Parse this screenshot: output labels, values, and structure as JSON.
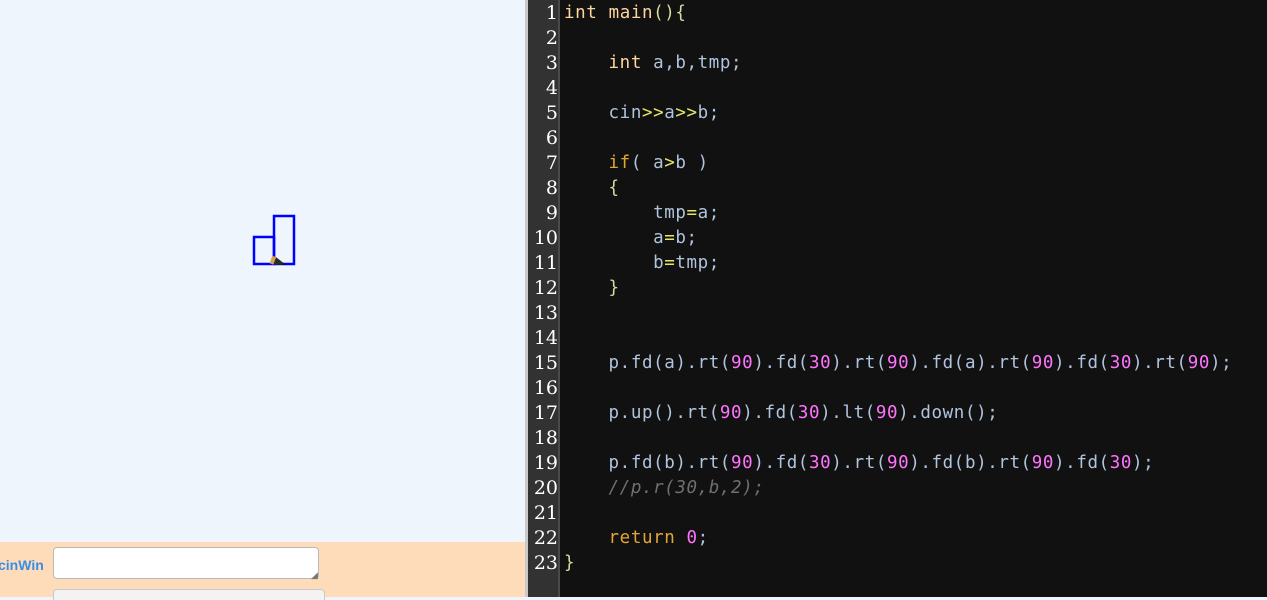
{
  "input": {
    "label": "cinWin",
    "value": ""
  },
  "colors": {
    "canvas_background": "#eef5fd",
    "input_strip_background": "#ffdcb9",
    "editor_background": "#111111",
    "gutter_background": "#323232",
    "turtle_stroke": "#0000ff",
    "keyword": "#ffd59e",
    "control_keyword": "#e2a733",
    "number": "#ff73fd",
    "operator": "#e6e66a",
    "identifier": "#b0c4de",
    "comment": "#6f6f6f"
  },
  "editor": {
    "line_numbers": [
      "1",
      "2",
      "3",
      "4",
      "5",
      "6",
      "7",
      "8",
      "9",
      "10",
      "11",
      "12",
      "13",
      "14",
      "15",
      "16",
      "17",
      "18",
      "19",
      "20",
      "21",
      "22",
      "23"
    ],
    "lines": [
      [
        {
          "t": "int",
          "k": "kw"
        },
        {
          "t": " "
        },
        {
          "t": "main",
          "k": "kw"
        },
        {
          "t": "(){",
          "k": "brace"
        }
      ],
      [],
      [
        {
          "t": "    "
        },
        {
          "t": "int",
          "k": "kw"
        },
        {
          "t": " a,b,tmp;"
        }
      ],
      [],
      [
        {
          "t": "    cin"
        },
        {
          "t": ">>",
          "k": "op"
        },
        {
          "t": "a"
        },
        {
          "t": ">>",
          "k": "op"
        },
        {
          "t": "b;"
        }
      ],
      [],
      [
        {
          "t": "    "
        },
        {
          "t": "if",
          "k": "ctl"
        },
        {
          "t": "( a"
        },
        {
          "t": ">",
          "k": "op"
        },
        {
          "t": "b )"
        }
      ],
      [
        {
          "t": "    "
        },
        {
          "t": "{",
          "k": "brace"
        }
      ],
      [
        {
          "t": "        tmp"
        },
        {
          "t": "=",
          "k": "op"
        },
        {
          "t": "a;"
        }
      ],
      [
        {
          "t": "        a"
        },
        {
          "t": "=",
          "k": "op"
        },
        {
          "t": "b;"
        }
      ],
      [
        {
          "t": "        b"
        },
        {
          "t": "=",
          "k": "op"
        },
        {
          "t": "tmp;"
        }
      ],
      [
        {
          "t": "    "
        },
        {
          "t": "}",
          "k": "brace"
        }
      ],
      [],
      [],
      [
        {
          "t": "    p.fd(a).rt("
        },
        {
          "t": "90",
          "k": "num"
        },
        {
          "t": ").fd("
        },
        {
          "t": "30",
          "k": "num"
        },
        {
          "t": ").rt("
        },
        {
          "t": "90",
          "k": "num"
        },
        {
          "t": ").fd(a).rt("
        },
        {
          "t": "90",
          "k": "num"
        },
        {
          "t": ").fd("
        },
        {
          "t": "30",
          "k": "num"
        },
        {
          "t": ").rt("
        },
        {
          "t": "90",
          "k": "num"
        },
        {
          "t": ");"
        }
      ],
      [],
      [
        {
          "t": "    p.up().rt("
        },
        {
          "t": "90",
          "k": "num"
        },
        {
          "t": ").fd("
        },
        {
          "t": "30",
          "k": "num"
        },
        {
          "t": ").lt("
        },
        {
          "t": "90",
          "k": "num"
        },
        {
          "t": ").down();"
        }
      ],
      [],
      [
        {
          "t": "    p.fd(b).rt("
        },
        {
          "t": "90",
          "k": "num"
        },
        {
          "t": ").fd("
        },
        {
          "t": "30",
          "k": "num"
        },
        {
          "t": ").rt("
        },
        {
          "t": "90",
          "k": "num"
        },
        {
          "t": ").fd(b).rt("
        },
        {
          "t": "90",
          "k": "num"
        },
        {
          "t": ").fd("
        },
        {
          "t": "30",
          "k": "num"
        },
        {
          "t": ");"
        }
      ],
      [
        {
          "t": "    "
        },
        {
          "t": "//p.r(30,b,2);",
          "k": "comment"
        }
      ],
      [],
      [
        {
          "t": "    "
        },
        {
          "t": "return",
          "k": "ctl"
        },
        {
          "t": " "
        },
        {
          "t": "0",
          "k": "num"
        },
        {
          "t": ";"
        }
      ],
      [
        {
          "t": "}",
          "k": "brace"
        }
      ]
    ]
  }
}
